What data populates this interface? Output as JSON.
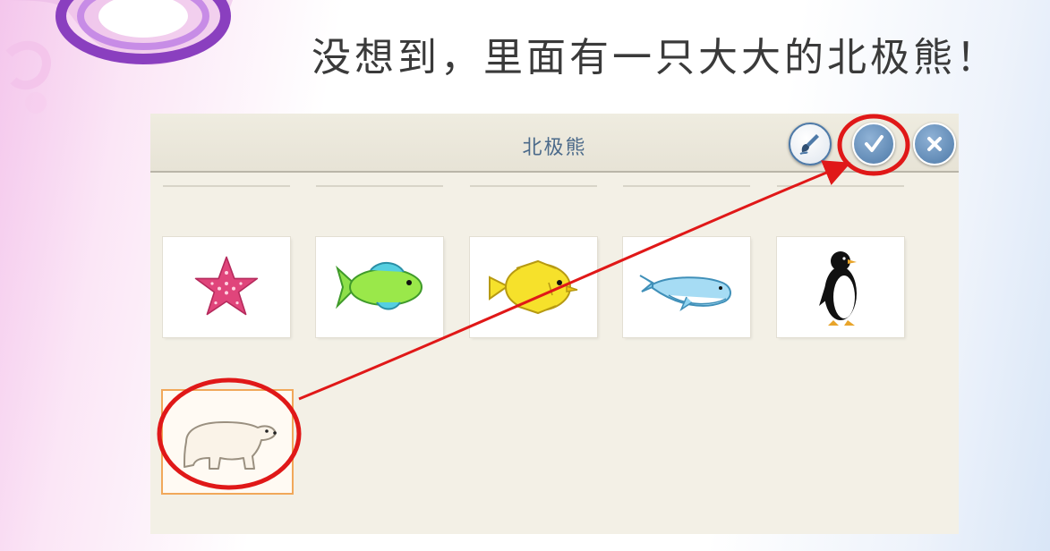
{
  "slide": {
    "heading": "没想到，里面有一只大大的北极熊！"
  },
  "app": {
    "title": "北极熊",
    "toolbar": {
      "paint_icon": "paintbrush-icon",
      "confirm_icon": "checkmark-icon",
      "close_icon": "close-icon"
    },
    "animals": [
      {
        "name": "starfish",
        "icon": "starfish-icon",
        "color": "#e0457b"
      },
      {
        "name": "green-fish",
        "icon": "fish-icon",
        "color": "#7ee03a"
      },
      {
        "name": "yellow-fish",
        "icon": "fish-icon",
        "color": "#f6e12b"
      },
      {
        "name": "whale",
        "icon": "whale-icon",
        "color": "#8fd3f0"
      },
      {
        "name": "penguin",
        "icon": "penguin-icon",
        "color": "#111111"
      },
      {
        "name": "polar-bear",
        "icon": "polar-bear-icon",
        "color": "#faf3e8",
        "selected": true
      }
    ]
  },
  "annotation": {
    "highlight_color": "#e01818"
  }
}
